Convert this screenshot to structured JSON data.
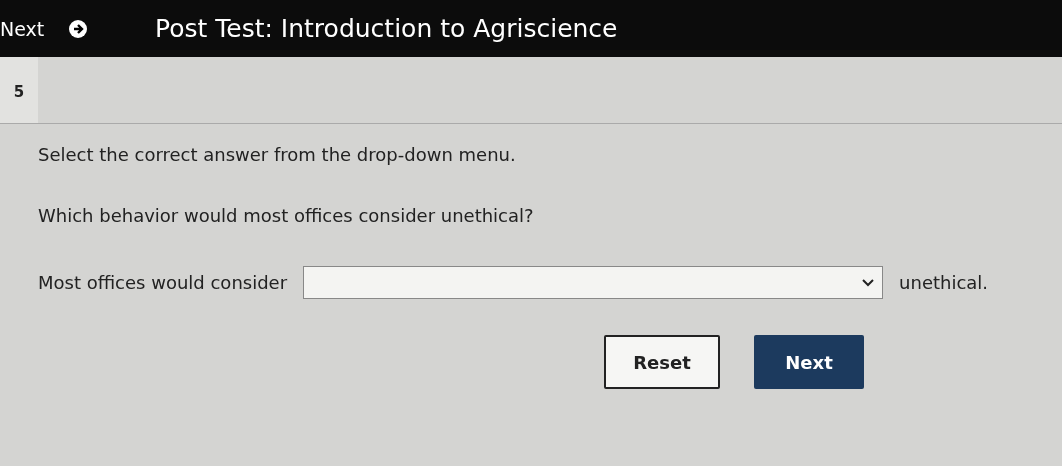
{
  "top_bar": {
    "next_label": "Next",
    "title": "Post Test: Introduction to Agriscience"
  },
  "question_number": "5",
  "instruction": "Select the correct answer from the drop-down menu.",
  "question": "Which behavior would most offices consider unethical?",
  "sentence": {
    "before": "Most offices would consider",
    "after": "unethical."
  },
  "buttons": [
    {
      "label": "Reset",
      "kind": "secondary"
    },
    {
      "label": "Next",
      "kind": "primary"
    }
  ]
}
